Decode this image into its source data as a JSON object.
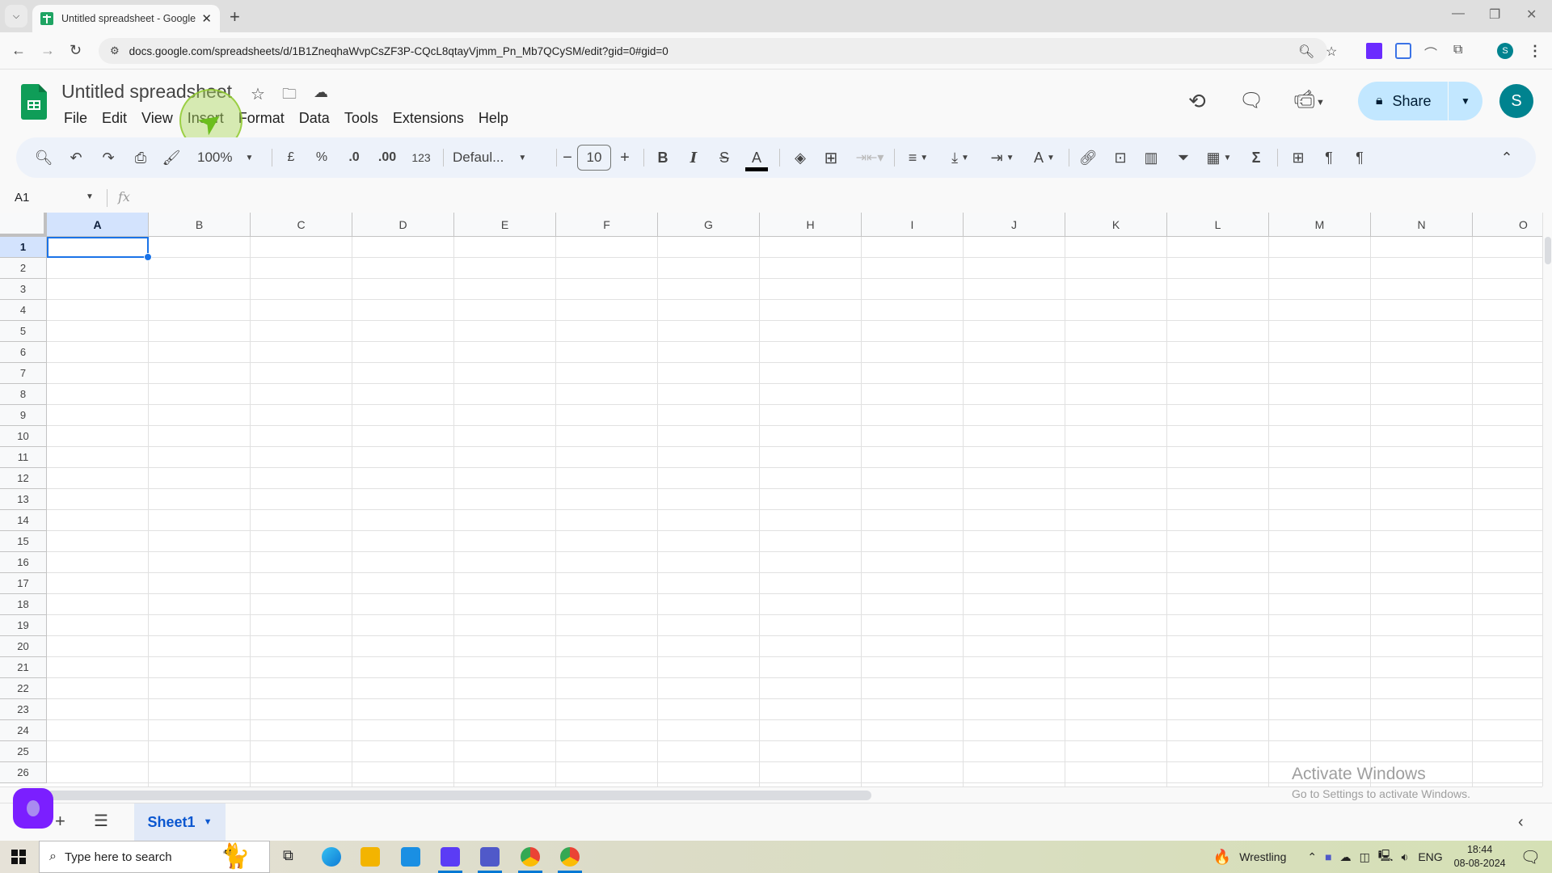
{
  "browser": {
    "tab_title": "Untitled spreadsheet - Google Sheets",
    "tab_title_visible": "Untitled spreadsheet - Google S",
    "url": "docs.google.com/spreadsheets/d/1B1ZneqhaWvpCsZF3P-CQcL8qtayVjmm_Pn_Mb7QCySM/edit?gid=0#gid=0",
    "profile_initial": "S"
  },
  "app": {
    "doc_title": "Untitled spreadsheet",
    "menu": [
      "File",
      "Edit",
      "View",
      "Insert",
      "Format",
      "Data",
      "Tools",
      "Extensions",
      "Help"
    ],
    "share_label": "Share",
    "avatar_initial": "S",
    "accent": "#0b57d0",
    "share_bg": "#c2e7ff"
  },
  "toolbar": {
    "zoom": "100%",
    "currency": "£",
    "percent": "%",
    "decrease_decimal": ".0",
    "increase_decimal": ".00",
    "number_format": "123",
    "font": "Defaul...",
    "font_size": "10",
    "bold": "B",
    "italic": "I",
    "sigma": "Σ"
  },
  "formula_bar": {
    "name_box": "A1",
    "fx": "fx",
    "value": ""
  },
  "grid": {
    "columns": [
      "A",
      "B",
      "C",
      "D",
      "E",
      "F",
      "G",
      "H",
      "I",
      "J",
      "K",
      "L",
      "M",
      "N",
      "O"
    ],
    "rows": [
      "1",
      "2",
      "3",
      "4",
      "5",
      "6",
      "7",
      "8",
      "9",
      "10",
      "11",
      "12",
      "13",
      "14",
      "15",
      "16",
      "17",
      "18",
      "19",
      "20",
      "21",
      "22",
      "23",
      "24",
      "25",
      "26"
    ],
    "selected_cell": "A1"
  },
  "sheets": {
    "tabs": [
      "Sheet1"
    ],
    "active": "Sheet1"
  },
  "watermark": {
    "line1": "Activate Windows",
    "line2": "Go to Settings to activate Windows."
  },
  "taskbar": {
    "search_placeholder": "Type here to search",
    "weather": "Wrestling",
    "language": "ENG",
    "time": "18:44",
    "date": "08-08-2024"
  }
}
